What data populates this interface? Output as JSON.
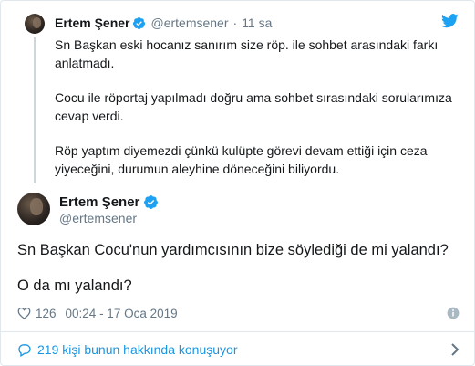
{
  "parent_tweet": {
    "name": "Ertem Şener",
    "handle": "@ertemsener",
    "separator": "·",
    "time": "11 sa",
    "paragraphs": [
      "Sn Başkan eski hocanız sanırım size röp. ile sohbet arasındaki farkı anlatmadı.",
      "Cocu ile röportaj yapılmadı doğru ama sohbet sırasındaki sorularımıza cevap verdi.",
      "Röp yaptım diyemezdi çünkü kulüpte görevi devam ettiği için ceza yiyeceğini, durumun aleyhine döneceğini biliyordu."
    ]
  },
  "main_tweet": {
    "name": "Ertem Şener",
    "handle": "@ertemsener",
    "paragraphs": [
      "Sn Başkan Cocu'nun yardımcısının bize söylediği de mi yalandı?",
      "O da mı yalandı?"
    ],
    "likes": "126",
    "timestamp": "00:24 - 17 Oca 2019"
  },
  "conversation_link": "219 kişi bunun hakkında konuşuyor",
  "colors": {
    "accent": "#1da1f2",
    "link": "#1b95e0",
    "muted": "#657786",
    "text": "#14171a",
    "border": "#e1e8ed"
  },
  "icons": [
    "verified-badge-icon",
    "twitter-bird-icon",
    "heart-icon",
    "info-icon",
    "speech-bubble-icon",
    "chevron-right-icon"
  ]
}
